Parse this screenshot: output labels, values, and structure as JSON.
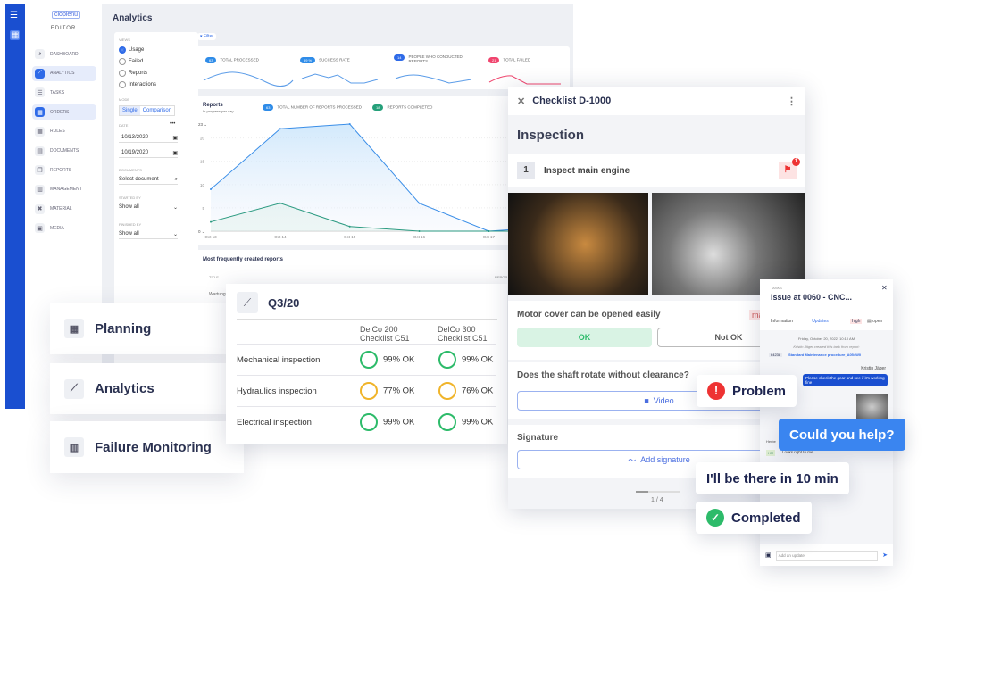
{
  "app": {
    "logo": "cloplenu",
    "section": "EDITOR",
    "title": "Analytics"
  },
  "nav": [
    {
      "label": "DASHBOARD",
      "icon": "pie-icon"
    },
    {
      "label": "ANALYTICS",
      "icon": "chart-icon",
      "selected": true
    },
    {
      "label": "TASKS",
      "icon": "list-icon"
    },
    {
      "label": "ORDERS",
      "icon": "calendar-icon",
      "selected": true
    },
    {
      "label": "RULES",
      "icon": "calendar-icon"
    },
    {
      "label": "DOCUMENTS",
      "icon": "document-icon"
    },
    {
      "label": "REPORTS",
      "icon": "copy-icon"
    },
    {
      "label": "MANAGEMENT",
      "icon": "table-icon"
    },
    {
      "label": "MATERIAL",
      "icon": "tools-icon"
    },
    {
      "label": "MEDIA",
      "icon": "media-icon"
    }
  ],
  "filters": {
    "views_label": "VIEWS",
    "views": [
      "Usage",
      "Failed",
      "Reports",
      "Interactions"
    ],
    "selected_view": "Usage",
    "mode_label": "MODE",
    "mode": [
      "Single",
      "Comparison"
    ],
    "date_label": "DATE",
    "date_from": "10/13/2020",
    "date_to": "10/19/2020",
    "documents_label": "DOCUMENTS",
    "documents_placeholder": "Select document",
    "started_label": "STARTED BY",
    "started": "Show all",
    "finished_label": "FINISHED BY",
    "finished": "Show all",
    "filter_button": "Filter"
  },
  "stats": [
    {
      "value": "63",
      "label": "TOTAL PROCESSED",
      "color": "#2f8ce8"
    },
    {
      "value": "59 %",
      "label": "SUCCESS RATE",
      "color": "#2f8ce8"
    },
    {
      "value": "14",
      "label": "PEOPLE WHO CONDUCTED REPORTS",
      "color": "#2f6be8"
    },
    {
      "value": "21",
      "label": "TOTAL FAILED",
      "color": "#f0456e"
    }
  ],
  "reports": {
    "title": "Reports",
    "subtitle": "In progress per day",
    "legend": [
      {
        "value": "63",
        "label": "TOTAL NUMBER OF REPORTS PROCESSED",
        "color": "#2f8ce8"
      },
      {
        "value": "18",
        "label": "REPORTS COMPLETED",
        "color": "#25a07a"
      }
    ],
    "ymax_select": "23",
    "ymin_select": "0"
  },
  "chart_data": {
    "type": "area",
    "categories": [
      "Oct 13",
      "Oct 14",
      "Oct 15",
      "Oct 16",
      "Oct 17",
      "Oct 18"
    ],
    "yticks": [
      5,
      10,
      15,
      20
    ],
    "ylim": [
      0,
      23
    ],
    "series": [
      {
        "values": [
          9,
          22,
          23,
          6,
          0,
          1
        ],
        "color": "#3a8ee8"
      },
      {
        "values": [
          2,
          6,
          1,
          0,
          0,
          0
        ],
        "color": "#2a9a80"
      }
    ]
  },
  "frequent": {
    "title": "Most frequently created reports",
    "col_title": "TITLE",
    "col_report": "REPOR",
    "row1": "Wartung"
  },
  "features": [
    "Planning",
    "Analytics",
    "Failure Monitoring"
  ],
  "quarter": {
    "title": "Q3/20",
    "cols": [
      "DelCo 200 Checklist C51",
      "DelCo 300 Checklist C51"
    ],
    "rows": [
      {
        "name": "Mechanical inspection",
        "a": "99% OK",
        "b": "99% OK"
      },
      {
        "name": "Hydraulics inspection",
        "a": "77% OK",
        "b": "76% OK"
      },
      {
        "name": "Electrical inspection",
        "a": "99% OK",
        "b": "99% OK"
      }
    ]
  },
  "checklist": {
    "title": "Checklist D-1000",
    "section": "Inspection",
    "step_num": "1",
    "step": "Inspect main engine",
    "flag_count": "1",
    "q1": "Motor cover can be opened easily",
    "tag": "ma",
    "ok": "OK",
    "notok": "Not OK",
    "q2": "Does the shaft rotate without clearance?",
    "video": "Video",
    "sig_label": "Signature",
    "sig_button": "Add signature",
    "page": "1 / 4"
  },
  "task": {
    "label": "TASKS",
    "title": "Issue at 0060 - CNC...",
    "tabs": [
      "Information",
      "Updates"
    ],
    "priority": "high",
    "status": "open",
    "date": "Friday, October 20, 2022, 10:10 AM",
    "created": "Kristin Jäger created this task from report:",
    "report_id": "64238",
    "report_name": "Standard Maintenance procedure_A054W0",
    "sender": "Kristin Jäger",
    "message": "Please check the gear and see if it's working fine",
    "reply_name": "Herbe",
    "reply_initials": "HM",
    "reply": "Looks right to me",
    "input_placeholder": "Add an update"
  },
  "bubbles": {
    "problem": "Problem",
    "help": "Could you help?",
    "eta": "I'll be there in 10 min",
    "done": "Completed"
  }
}
